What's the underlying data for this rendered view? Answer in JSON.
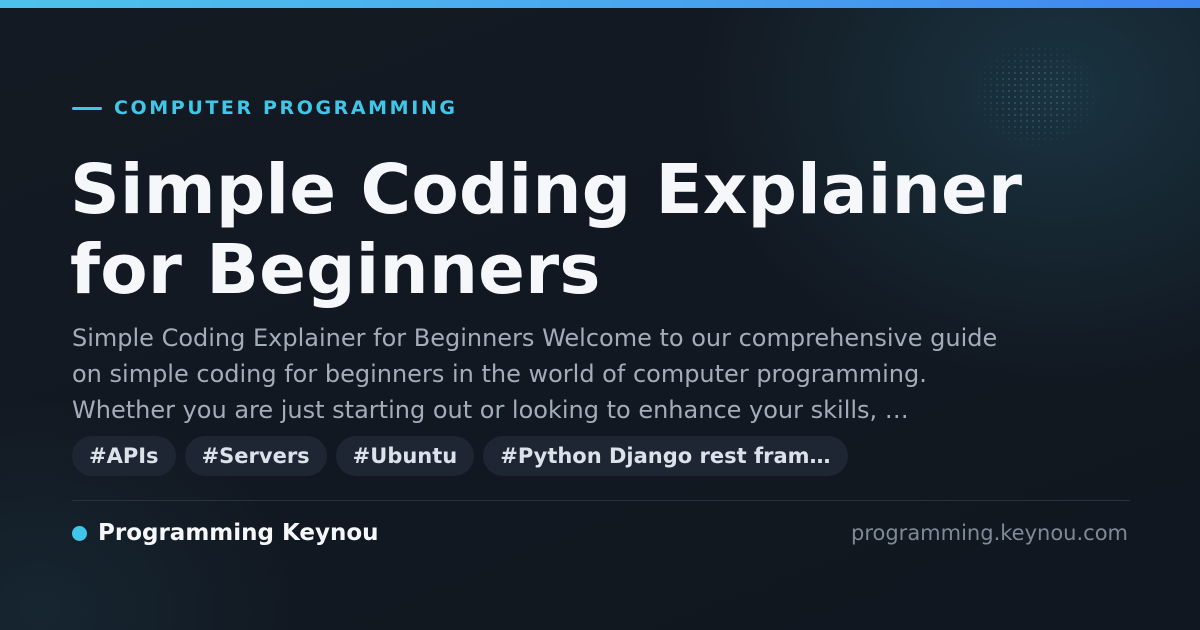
{
  "eyebrow": {
    "label": "COMPUTER PROGRAMMING"
  },
  "article": {
    "title_line1": "Simple Coding Explainer",
    "title_line2": "for Beginners",
    "summary": "Simple Coding Explainer for Beginners Welcome to our comprehensive guide\non simple coding for beginners in the world of computer programming.\nWhether you are just starting out or looking to enhance your skills, …"
  },
  "tags": [
    "#APIs",
    "#Servers",
    "#Ubuntu",
    "#Python Django rest fram…"
  ],
  "footer": {
    "site_name": "Programming Keynou",
    "domain": "programming.keynou.com"
  },
  "colors": {
    "accent": "#3fc7ea",
    "gradient_start": "#4dc3ec",
    "gradient_end": "#3f86f0",
    "background": "#121821",
    "title": "#f5f7fa",
    "body_text": "#a3adba",
    "tag_background": "#1d2632"
  }
}
